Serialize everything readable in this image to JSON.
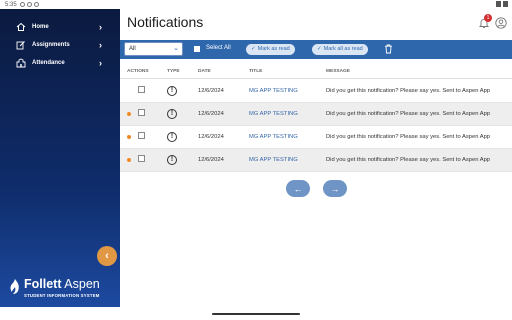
{
  "status_bar": {
    "time": "5:35"
  },
  "sidebar": {
    "items": [
      {
        "label": "Home",
        "icon": "home-icon"
      },
      {
        "label": "Assignments",
        "icon": "edit-icon"
      },
      {
        "label": "Attendance",
        "icon": "school-icon"
      }
    ],
    "collapse_icon": "chevron-left-icon",
    "brand": {
      "name_bold": "Follett",
      "name_rest": " Aspen",
      "tagline": "STUDENT INFORMATION SYSTEM"
    }
  },
  "header": {
    "title": "Notifications",
    "badge_count": "1",
    "icons": [
      "bell-icon",
      "account-icon"
    ]
  },
  "toolbar": {
    "filter_value": "All",
    "select_all_label": "Select All",
    "mark_read_label": "Mark as read",
    "mark_all_read_label": "Mark all as read"
  },
  "table": {
    "columns": [
      "ACTIONS",
      "TYPE",
      "DATE",
      "TITLE",
      "MESSAGE"
    ],
    "rows": [
      {
        "unread": false,
        "date": "12/6/2024",
        "title": "MG APP TESTING",
        "message": "Did you get this notification? Please say yes. Sent to Aspen App"
      },
      {
        "unread": true,
        "date": "12/6/2024",
        "title": "MG APP TESTING",
        "message": "Did you get this notification? Please say yes. Sent to Aspen App"
      },
      {
        "unread": true,
        "date": "12/6/2024",
        "title": "MG APP TESTING",
        "message": "Did you get this notification? Please say yes. Sent to Aspen App"
      },
      {
        "unread": true,
        "date": "12/6/2024",
        "title": "MG APP TESTING",
        "message": "Did you get this notification? Please say yes. Sent to Aspen App"
      }
    ]
  },
  "pagination": {
    "prev_icon": "arrow-left-icon",
    "next_icon": "arrow-right-icon"
  },
  "colors": {
    "sidebar_top": "#0b1a3f",
    "sidebar_bottom": "#1d4aa0",
    "toolbar": "#2f67ad",
    "unread_dot": "#f08a24",
    "collapse_button": "#e19845",
    "badge": "#d32f2f"
  }
}
